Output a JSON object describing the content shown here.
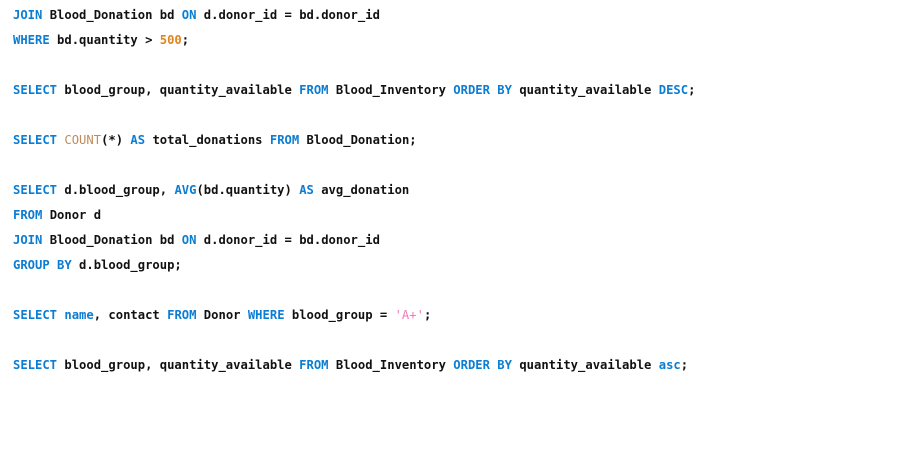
{
  "editor": {
    "lines": [
      [
        {
          "t": "JOIN",
          "k": "kw"
        },
        {
          "t": " Blood_Donation bd ",
          "k": "txt"
        },
        {
          "t": "ON",
          "k": "kw"
        },
        {
          "t": " d.donor_id = bd.donor_id",
          "k": "txt"
        }
      ],
      [
        {
          "t": "WHERE",
          "k": "kw"
        },
        {
          "t": " bd.quantity > ",
          "k": "txt"
        },
        {
          "t": "500",
          "k": "num"
        },
        {
          "t": ";",
          "k": "txt"
        }
      ],
      [],
      [
        {
          "t": "SELECT",
          "k": "kw"
        },
        {
          "t": " blood_group, quantity_available ",
          "k": "txt"
        },
        {
          "t": "FROM",
          "k": "kw"
        },
        {
          "t": " Blood_Inventory ",
          "k": "txt"
        },
        {
          "t": "ORDER BY",
          "k": "kw"
        },
        {
          "t": " quantity_available ",
          "k": "txt"
        },
        {
          "t": "DESC",
          "k": "kw"
        },
        {
          "t": ";",
          "k": "txt"
        }
      ],
      [],
      [
        {
          "t": "SELECT",
          "k": "kw"
        },
        {
          "t": " ",
          "k": "txt"
        },
        {
          "t": "COUNT",
          "k": "fn"
        },
        {
          "t": "(*) ",
          "k": "txt"
        },
        {
          "t": "AS",
          "k": "kw"
        },
        {
          "t": " total_donations ",
          "k": "txt"
        },
        {
          "t": "FROM",
          "k": "kw"
        },
        {
          "t": " Blood_Donation;",
          "k": "txt"
        }
      ],
      [],
      [
        {
          "t": "SELECT",
          "k": "kw"
        },
        {
          "t": " d.blood_group, ",
          "k": "txt"
        },
        {
          "t": "AVG",
          "k": "kw"
        },
        {
          "t": "(bd.quantity) ",
          "k": "txt"
        },
        {
          "t": "AS",
          "k": "kw"
        },
        {
          "t": " avg_donation",
          "k": "txt"
        }
      ],
      [
        {
          "t": "FROM",
          "k": "kw"
        },
        {
          "t": " Donor d",
          "k": "txt"
        }
      ],
      [
        {
          "t": "JOIN",
          "k": "kw"
        },
        {
          "t": " Blood_Donation bd ",
          "k": "txt"
        },
        {
          "t": "ON",
          "k": "kw"
        },
        {
          "t": " d.donor_id = bd.donor_id",
          "k": "txt"
        }
      ],
      [
        {
          "t": "GROUP BY",
          "k": "kw"
        },
        {
          "t": " d.blood_group;",
          "k": "txt"
        }
      ],
      [],
      [
        {
          "t": "SELECT",
          "k": "kw"
        },
        {
          "t": " ",
          "k": "txt"
        },
        {
          "t": "name",
          "k": "kwn"
        },
        {
          "t": ", contact ",
          "k": "txt"
        },
        {
          "t": "FROM",
          "k": "kw"
        },
        {
          "t": " Donor ",
          "k": "txt"
        },
        {
          "t": "WHERE",
          "k": "kw"
        },
        {
          "t": " blood_group = ",
          "k": "txt"
        },
        {
          "t": "'A+'",
          "k": "str"
        },
        {
          "t": ";",
          "k": "txt"
        }
      ],
      [],
      [
        {
          "t": "SELECT",
          "k": "kw"
        },
        {
          "t": " blood_group, quantity_available ",
          "k": "txt"
        },
        {
          "t": "FROM",
          "k": "kw"
        },
        {
          "t": " Blood_Inventory ",
          "k": "txt"
        },
        {
          "t": "ORDER BY",
          "k": "kw"
        },
        {
          "t": " quantity_available ",
          "k": "txt"
        },
        {
          "t": "asc",
          "k": "kw"
        },
        {
          "t": ";",
          "k": "txt"
        }
      ]
    ]
  },
  "colors": {
    "keyword": "#0b7dd3",
    "function": "#c08b5a",
    "number": "#e0841f",
    "string": "#f07abd",
    "text": "#111111",
    "background": "#ffffff"
  }
}
